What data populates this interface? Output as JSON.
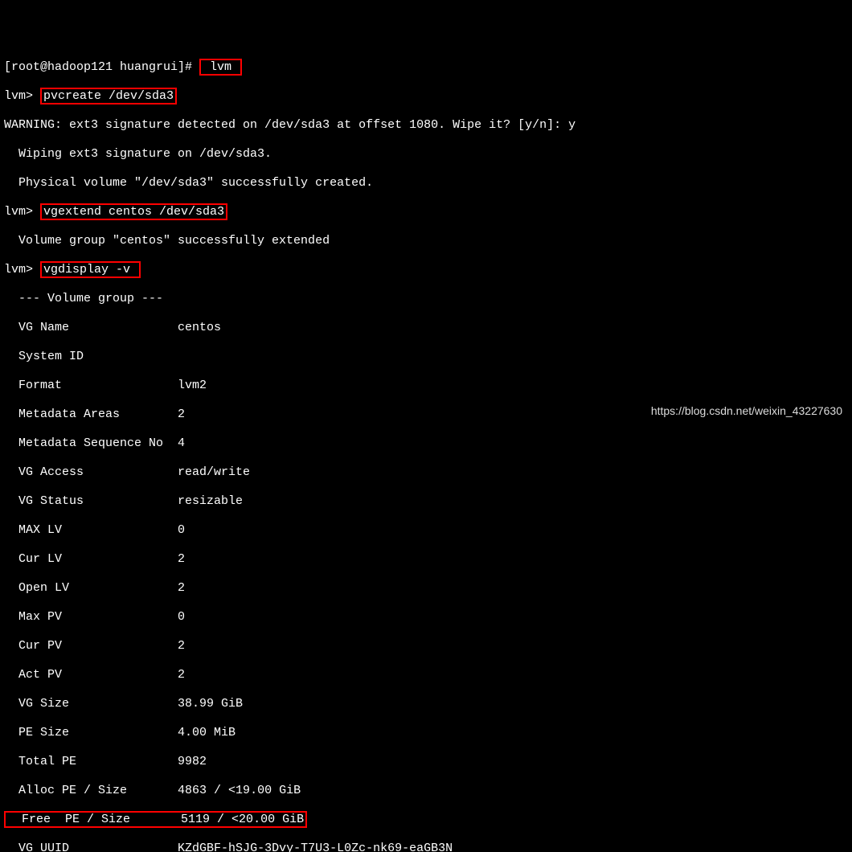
{
  "prompt_host": "[root@hadoop121 huangrui]# ",
  "cmd1": " lvm ",
  "lvm_prompt": "lvm> ",
  "cmd2": "pvcreate /dev/sda3",
  "warn_line": "WARNING: ext3 signature detected on /dev/sda3 at offset 1080. Wipe it? [y/n]: y",
  "wipe_line": "  Wiping ext3 signature on /dev/sda3.",
  "pv_created": "  Physical volume \"/dev/sda3\" successfully created.",
  "cmd3": "vgextend centos /dev/sda3",
  "vg_extended": "  Volume group \"centos\" successfully extended",
  "cmd4": "vgdisplay -v ",
  "vg_header": "  --- Volume group ---",
  "rows": {
    "vg_name": {
      "k": "  VG Name              ",
      "v": " centos"
    },
    "system_id": {
      "k": "  System ID            ",
      "v": ""
    },
    "format": {
      "k": "  Format               ",
      "v": " lvm2"
    },
    "meta_areas": {
      "k": "  Metadata Areas       ",
      "v": " 2"
    },
    "meta_seq": {
      "k": "  Metadata Sequence No ",
      "v": " 4"
    },
    "vg_access": {
      "k": "  VG Access            ",
      "v": " read/write"
    },
    "vg_status": {
      "k": "  VG Status            ",
      "v": " resizable"
    },
    "max_lv": {
      "k": "  MAX LV               ",
      "v": " 0"
    },
    "cur_lv": {
      "k": "  Cur LV               ",
      "v": " 2"
    },
    "open_lv": {
      "k": "  Open LV              ",
      "v": " 2"
    },
    "max_pv": {
      "k": "  Max PV               ",
      "v": " 0"
    },
    "cur_pv": {
      "k": "  Cur PV               ",
      "v": " 2"
    },
    "act_pv": {
      "k": "  Act PV               ",
      "v": " 2"
    },
    "vg_size": {
      "k": "  VG Size              ",
      "v": " 38.99 GiB"
    },
    "pe_size": {
      "k": "  PE Size              ",
      "v": " 4.00 MiB"
    },
    "total_pe": {
      "k": "  Total PE             ",
      "v": " 9982"
    },
    "alloc_pe": {
      "k": "  Alloc PE / Size      ",
      "v": " 4863 / <19.00 GiB"
    },
    "free_pe": {
      "k": "  Free  PE / Size      ",
      "v": " 5119 / <20.00 GiB"
    },
    "vg_uuid": {
      "k": "  VG UUID              ",
      "v": " KZdGBF-hSJG-3Dvy-T7U3-L0Zc-nk69-eaGB3N"
    }
  },
  "watermark": "https://blog.csdn.net/weixin_43227630"
}
